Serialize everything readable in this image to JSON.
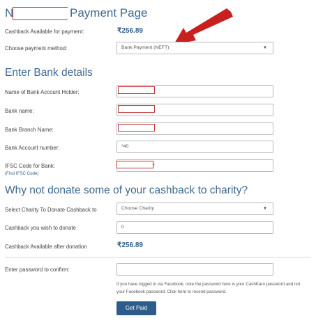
{
  "page": {
    "title_prefix": "N",
    "title_suffix": "Payment Page"
  },
  "cashback": {
    "label": "Cashback Available for payment:",
    "value": "₹256.89"
  },
  "payment_method": {
    "label": "Choose payment method:",
    "selected": "Bank Payment (NEFT)"
  },
  "bank": {
    "heading": "Enter Bank details",
    "holder_label": "Name of Bank Account Holder:",
    "name_label": "Bank name:",
    "branch_label": "Bank Branch Name:",
    "account_label": "Bank Account number:",
    "account_value": "*40",
    "ifsc_label": "IFSC Code for Bank:",
    "ifsc_value": "2",
    "find_ifsc": "(Find IFSC Code)"
  },
  "charity": {
    "heading": "Why not donate some of your cashback to charity?",
    "select_label": "Select Charity To Donate Cashback to",
    "select_value": "Choose Charity",
    "donate_label": "Cashback you wish to donate",
    "donate_value": "0",
    "after_label": "Cashback Available after donation",
    "after_value": "₹256.89"
  },
  "confirm": {
    "password_label": "Enter password to confirm:",
    "note": "If you have logged in via Facebook, note the password here is your CashKaro password and not your Facebook password. Click here to resend password.",
    "button": "Get Paid"
  },
  "colors": {
    "heading": "#3e6a93",
    "button": "#2e5c8a",
    "redaction": "#c23a3a",
    "arrow": "#c8201e"
  },
  "icons": {
    "dropdown": "chevron-down-icon",
    "annotation": "arrow-icon"
  }
}
